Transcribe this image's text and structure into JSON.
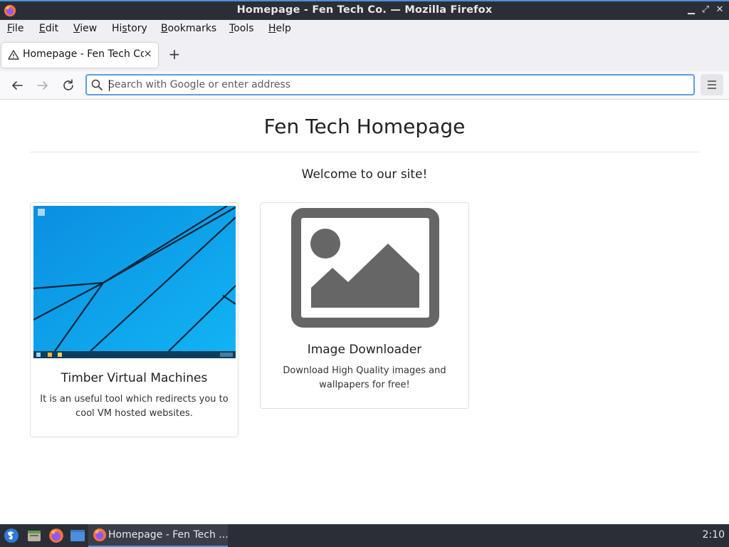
{
  "window": {
    "title": "Homepage - Fen Tech Co. — Mozilla Firefox"
  },
  "menubar": {
    "items": [
      {
        "label": "File",
        "key": "F",
        "rest": "ile"
      },
      {
        "label": "Edit",
        "key": "E",
        "rest": "dit"
      },
      {
        "label": "View",
        "key": "V",
        "rest": "iew"
      },
      {
        "label": "History",
        "key": "s",
        "pre": "Hi",
        "rest": "tory"
      },
      {
        "label": "Bookmarks",
        "key": "B",
        "rest": "ookmarks"
      },
      {
        "label": "Tools",
        "key": "T",
        "rest": "ools"
      },
      {
        "label": "Help",
        "key": "H",
        "rest": "elp"
      }
    ]
  },
  "tabs": [
    {
      "label": "Homepage - Fen Tech Co.",
      "close": "×"
    }
  ],
  "new_tab": "+",
  "urlbar": {
    "value": "",
    "placeholder": "Search with Google or enter address"
  },
  "page": {
    "title": "Fen Tech Homepage",
    "welcome": "Welcome to our site!",
    "cards": [
      {
        "title": "Timber Virtual Machines",
        "text": "It is an useful tool which redirects you to cool VM hosted websites."
      },
      {
        "title": "Image Downloader",
        "text": "Download High Quality images and wallpapers for free!"
      }
    ]
  },
  "taskbar": {
    "window_label": "Homepage - Fen Tech ...",
    "clock": "2:10"
  },
  "colors": {
    "accent": "#4a90d9",
    "titlebar_bg": "#2b2e37",
    "placeholder_image": "#666666",
    "desktop_blue": "#0aa3e8"
  }
}
